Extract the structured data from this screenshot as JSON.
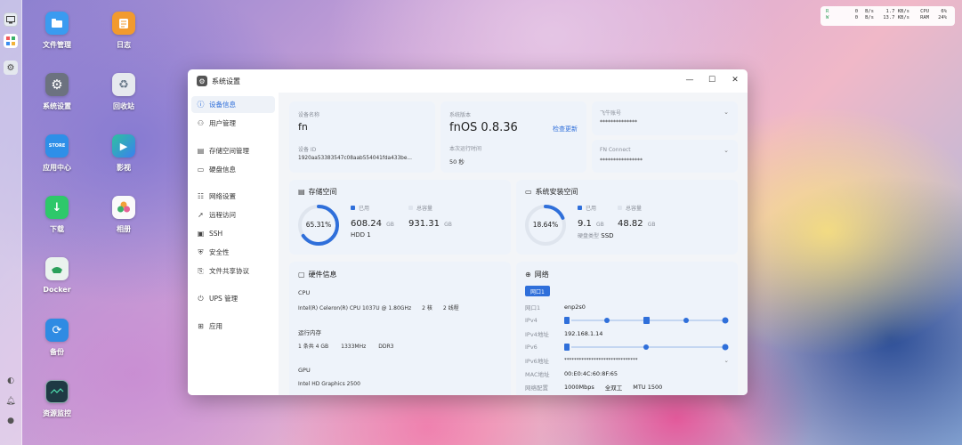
{
  "dock": {
    "icons": [
      "monitor-icon",
      "apps-icon",
      "settings-icon",
      "bottom-1-icon",
      "bell-icon",
      "user-icon"
    ]
  },
  "desktop": {
    "icons": [
      {
        "id": "files",
        "label": "文件管理",
        "color": "#3a9bf0"
      },
      {
        "id": "logs",
        "label": "日志",
        "color": "#f29a2e"
      },
      {
        "id": "settings",
        "label": "系统设置",
        "color": "#6c7280"
      },
      {
        "id": "recycle",
        "label": "回收站",
        "color": "#d8dde4"
      },
      {
        "id": "appcenter",
        "label": "应用中心",
        "color": "#2e8fe8"
      },
      {
        "id": "video",
        "label": "影视",
        "color": "#20b0a0"
      },
      {
        "id": "download",
        "label": "下载",
        "color": "#2ec86a"
      },
      {
        "id": "photos",
        "label": "相册",
        "color": "#f7f7f7"
      },
      {
        "id": "docker",
        "label": "Docker",
        "color": "#e9f3ec"
      },
      {
        "id": "backup",
        "label": "备份",
        "color": "#2f8be3"
      },
      {
        "id": "monitor",
        "label": "资源监控",
        "color": "#1f3a44"
      }
    ]
  },
  "monitor": {
    "r_label": "R",
    "w_label": "W",
    "r_val": "0",
    "r_unit": "B/s",
    "r_val2": "1.7 KB/s",
    "cpu_label": "CPU",
    "cpu_val": "6%",
    "w_val": "0",
    "w_unit": "B/s",
    "w_val2": "13.7 KB/s",
    "ram_label": "RAM",
    "ram_val": "24%"
  },
  "window": {
    "title": "系统设置",
    "controls": {
      "min": "—",
      "max": "☐",
      "close": "✕"
    },
    "sidebar": [
      {
        "label": "设备信息",
        "icon": "device-icon",
        "active": true
      },
      {
        "label": "用户管理",
        "icon": "user-icon"
      },
      {
        "label": "存储空间管理",
        "icon": "storage-icon"
      },
      {
        "label": "硬盘信息",
        "icon": "disk-icon"
      },
      {
        "label": "网络设置",
        "icon": "network-icon"
      },
      {
        "label": "远程访问",
        "icon": "remote-icon"
      },
      {
        "label": "SSH",
        "icon": "ssh-icon"
      },
      {
        "label": "安全性",
        "icon": "shield-icon"
      },
      {
        "label": "文件共享协议",
        "icon": "share-icon"
      },
      {
        "label": "UPS 管理",
        "icon": "ups-icon"
      },
      {
        "label": "应用",
        "icon": "apps-icon"
      }
    ],
    "device": {
      "name_label": "设备名称",
      "name": "fn",
      "id_label": "设备 ID",
      "id": "1920aa53383547c08aab554041fda433be...",
      "version_label": "系统版本",
      "version": "fnOS  0.8.36",
      "check_update": "检查更新",
      "uptime_label": "本次运行时间",
      "uptime": "50 秒",
      "account_label": "飞牛账号",
      "account": "**************",
      "connect_label": "FN Connect",
      "connect": "****************"
    },
    "storage": {
      "title": "存储空间",
      "percent": "65.31%",
      "percent_value": 65.31,
      "used_label": "已用",
      "used": "608.24",
      "used_unit": "GB",
      "total_label": "总容量",
      "total": "931.31",
      "total_unit": "GB",
      "disk_prefix": "HDD",
      "disk_count": "1"
    },
    "system_disk": {
      "title": "系统安装空间",
      "percent": "18.64%",
      "percent_value": 18.64,
      "used_label": "已用",
      "used": "9.1",
      "used_unit": "GB",
      "total_label": "总容量",
      "total": "48.82",
      "total_unit": "GB",
      "type_label": "硬盘类型",
      "type": "SSD"
    },
    "hardware": {
      "title": "硬件信息",
      "cpu_label": "CPU",
      "cpu": "Intel(R) Celeron(R) CPU 1037U @ 1.80GHz",
      "cores": "2 核",
      "threads": "2 线程",
      "mem_label": "运行内存",
      "mem": "1 条共 4 GB",
      "mem_speed": "1333MHz",
      "mem_type": "DDR3",
      "gpu_label": "GPU",
      "gpu": "Intel HD Graphics 2500"
    },
    "network": {
      "title": "网络",
      "tab": "网口1",
      "rows": [
        {
          "k": "网口1",
          "v": "enp2s0"
        },
        {
          "k": "IPv4",
          "v": ""
        },
        {
          "k": "IPv4地址",
          "v": "192.168.1.14"
        },
        {
          "k": "IPv6",
          "v": ""
        },
        {
          "k": "IPv6地址",
          "v": "******************************"
        },
        {
          "k": "MAC地址",
          "v": "00:E0:4C:60:8F:65"
        },
        {
          "k": "网络配置",
          "v": "1000Mbps"
        }
      ],
      "duplex": "全双工",
      "mtu": "MTU 1500"
    }
  },
  "colors": {
    "accent": "#2f6fda",
    "ring_track": "#e3e8f0"
  }
}
